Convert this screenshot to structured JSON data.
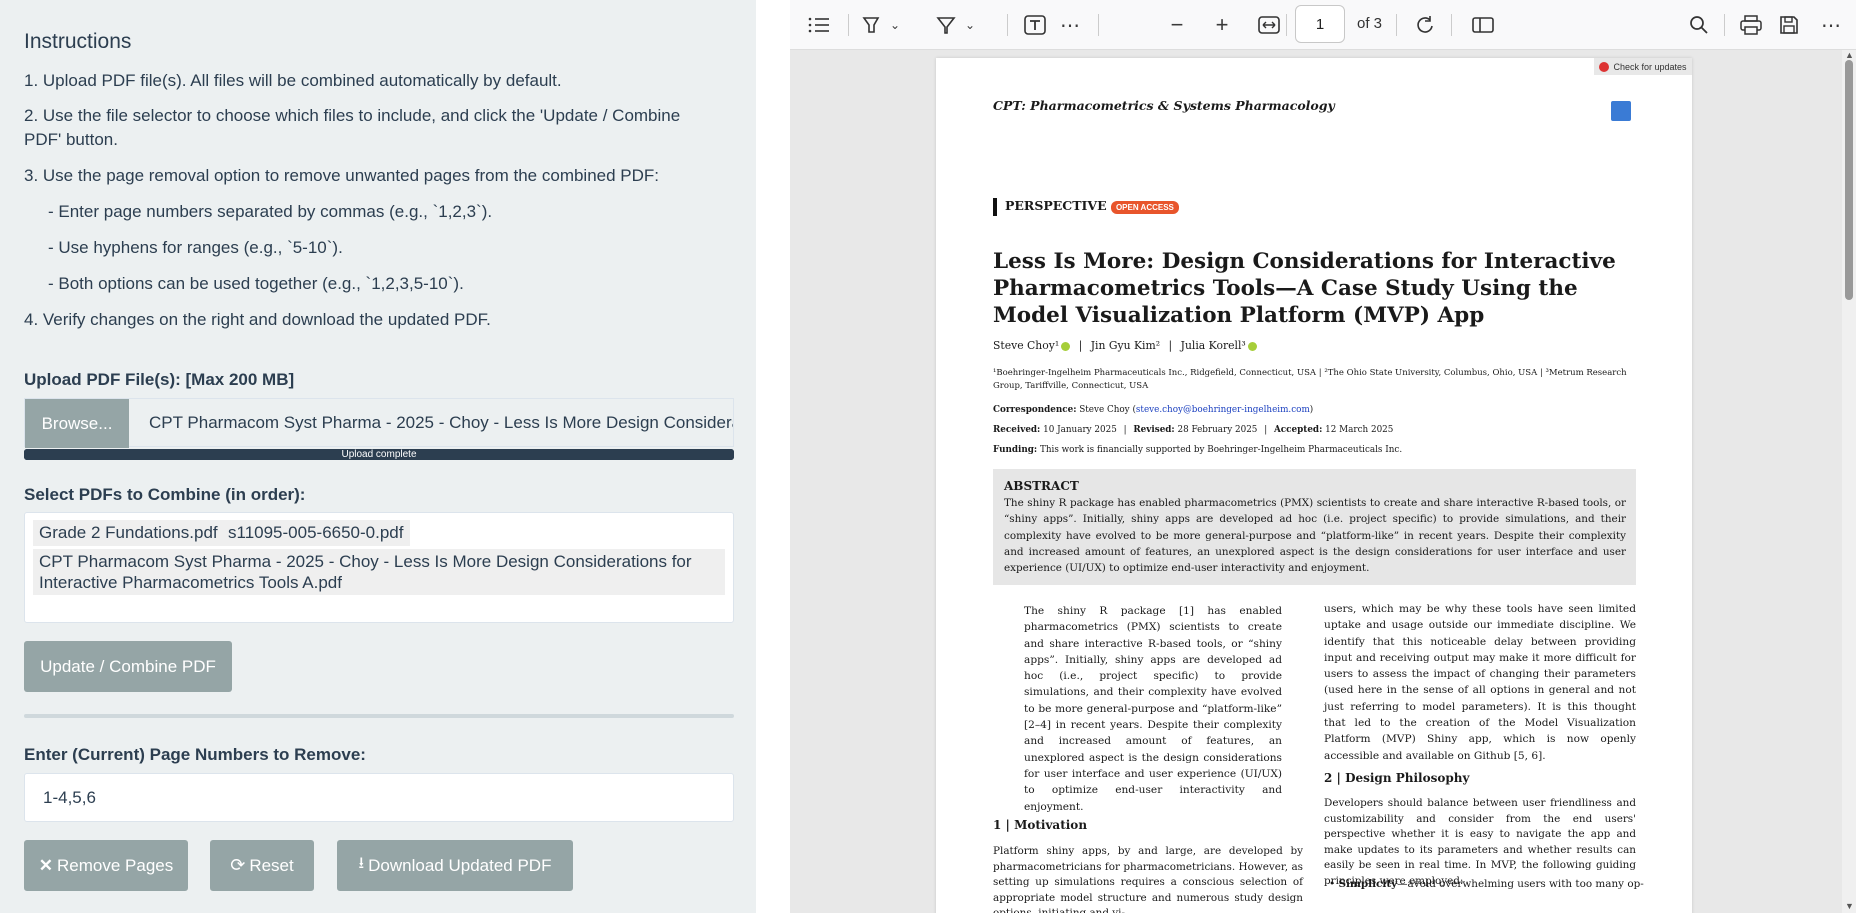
{
  "sidebar": {
    "instructions_title": "Instructions",
    "steps": [
      "1. Upload PDF file(s). All files will be combined automatically by default.",
      "2. Use the file selector to choose which files to include, and click the 'Update / Combine PDF' button.",
      "3. Use the page removal option to remove unwanted pages from the combined PDF:",
      "- Enter page numbers separated by commas (e.g., `1,2,3`).",
      "- Use hyphens for ranges (e.g., `5-10`).",
      "- Both options can be used together (e.g., `1,2,3,5-10`).",
      "4. Verify changes on the right and download the updated PDF."
    ],
    "upload_label": "Upload PDF File(s): [Max 200 MB]",
    "browse_label": "Browse...",
    "file_name": "CPT Pharmacom  Syst Pharma - 2025 - Choy - Less Is More  Design Considerations for Interactive Pharmacometrics Tools A.pdf",
    "progress_text": "Upload complete",
    "progress": 1.0,
    "select_label": "Select PDFs to Combine (in order):",
    "selected_files": [
      "Grade 2 Fundations.pdf",
      "s11095-005-6650-0.pdf",
      "CPT Pharmacom Syst Pharma - 2025 - Choy - Less Is More Design Considerations for Interactive Pharmacometrics Tools A.pdf"
    ],
    "combine_button": "Update / Combine PDF",
    "remove_label": "Enter (Current) Page Numbers to Remove:",
    "remove_value": "1-4,5,6",
    "remove_button": "Remove Pages",
    "reset_button": "Reset",
    "download_button": "Download Updated PDF"
  },
  "viewer": {
    "current_page": "1",
    "page_of": "of 3",
    "icons": [
      "outline-icon",
      "highlight-icon",
      "chevron-down-icon",
      "draw-icon",
      "chevron-down-icon",
      "text-icon",
      "more-icon",
      "zoom-out-icon",
      "zoom-in-icon",
      "fit-width-icon",
      "rotate-icon",
      "two-page-icon",
      "search-icon",
      "print-icon",
      "save-icon",
      "menu-icon"
    ]
  },
  "paper": {
    "check_updates": "Check for updates",
    "journal": "CPT: Pharmacometrics & Systems Pharmacology",
    "section": "PERSPECTIVE",
    "open_access": "OPEN ACCESS",
    "title": "Less Is More: Design Considerations for Interactive Pharmacometrics Tools—A Case Study Using the Model Visualization Platform (MVP) App",
    "authors": [
      "Steve Choy¹",
      "Jin Gyu Kim²",
      "Julia Korell³"
    ],
    "affiliations": "¹Boehringer-Ingelheim Pharmaceuticals Inc., Ridgefield, Connecticut, USA  |  ²The Ohio State University, Columbus, Ohio, USA  |  ³Metrum Research Group, Tariffville, Connecticut, USA",
    "correspondence_label": "Correspondence:",
    "correspondence": "Steve Choy (",
    "correspondence_email": "steve.choy@boehringer-ingelheim.com",
    "correspondence_end": ")",
    "received_label": "Received:",
    "received": "10 January 2025",
    "revised_label": "Revised:",
    "revised": "28 February 2025",
    "accepted_label": "Accepted:",
    "accepted": "12 March 2025",
    "funding_label": "Funding:",
    "funding": "This work is financially supported by Boehringer-Ingelheim Pharmaceuticals Inc.",
    "abstract_title": "ABSTRACT",
    "abstract": "The shiny R package has enabled pharmacometrics (PMX) scientists to create and share interactive R-based tools, or “shiny apps”. Initially, shiny apps are developed ad hoc (i.e. project specific) to provide simulations, and their complexity have evolved to be more general-purpose and “platform-like” in recent years. Despite their complexity and increased amount of features, an unexplored aspect is the design considerations for user interface and user experience (UI/UX) to optimize end-user interactivity and enjoyment.",
    "left_col": "The shiny R package [1] has enabled pharmacometrics (PMX) scientists to create and share interactive R-based tools, or “shiny apps”. Initially, shiny apps are developed ad hoc (i.e., project specific) to provide simulations, and their complexity have evolved to be more general-purpose and “platform-like” [2–4] in recent years. Despite their complexity and increased amount of features, an unexplored aspect is the design considerations for user interface and user experience (UI/UX) to optimize end-user interactivity and enjoyment.",
    "section1": "1  |  Motivation",
    "section1_text": "Platform shiny apps, by and large, are developed by pharmacometricians for pharmacometricians. However, as setting up simulations requires a conscious selection of appropriate model structure and numerous study design options, initiating and vi-",
    "right_col": "users, which may be why these tools have seen limited uptake and usage outside our immediate discipline. We identify that this noticeable delay between providing input and receiving output may make it more difficult for users to assess the impact of changing their parameters (used here in the sense of all options in general and not just referring to model parameters). It is this thought that led to the creation of the Model Visualization Platform (MVP) Shiny app, which is now openly accessible and available on Github [5, 6].",
    "section2": "2  |  Design Philosophy",
    "section2_text": "Developers should balance between user friendliness and customizability and consider from the end users' perspective whether it is easy to navigate the app and make updates to its parameters and whether results can easily be seen in real time. In MVP, the following guiding principles were employed:",
    "bullet": "Simplicity",
    "bullet_text": "—avoid overwhelming users with too many op-"
  }
}
